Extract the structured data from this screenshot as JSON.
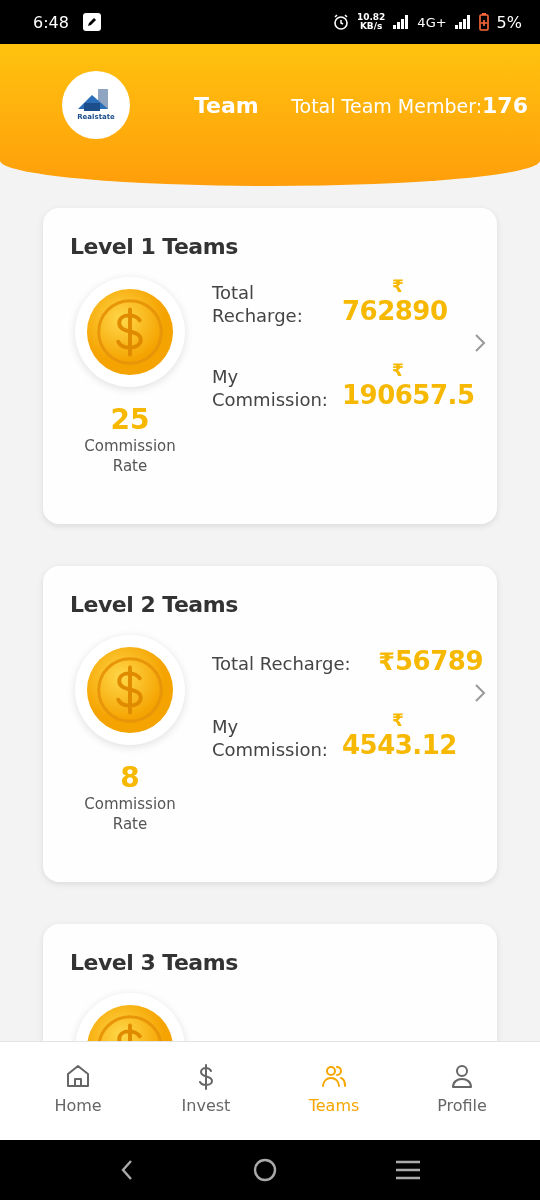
{
  "status_bar": {
    "time": "6:48",
    "speed": "10.82",
    "speed_unit": "KB/s",
    "network": "4G+",
    "battery": "5%"
  },
  "header": {
    "logo_text": "Realstate",
    "title": "Team",
    "member_label": "Total Team Member:",
    "member_count": "176"
  },
  "cards": [
    {
      "title": "Level 1 Teams",
      "rate": "25",
      "rate_label": "Commission Rate",
      "stats": [
        {
          "kind": "stacked",
          "label": "Total Recharge:",
          "currency": "₹",
          "value": "762890"
        },
        {
          "kind": "stacked",
          "label": "My Commission:",
          "currency": "₹",
          "value": "190657.5"
        }
      ]
    },
    {
      "title": "Level 2 Teams",
      "rate": "8",
      "rate_label": "Commission Rate",
      "stats": [
        {
          "kind": "inline",
          "label": "Total Recharge:",
          "currency": "₹",
          "value": "56789"
        },
        {
          "kind": "stacked",
          "label": "My Commission:",
          "currency": "₹",
          "value": "4543.12"
        }
      ]
    },
    {
      "title": "Level 3 Teams",
      "cut": true
    }
  ],
  "nav": [
    {
      "label": "Home",
      "kind": "home",
      "selected": false
    },
    {
      "label": "Invest",
      "kind": "dollar",
      "selected": false
    },
    {
      "label": "Teams",
      "kind": "people",
      "selected": true
    },
    {
      "label": "Profile",
      "kind": "person",
      "selected": false
    }
  ]
}
